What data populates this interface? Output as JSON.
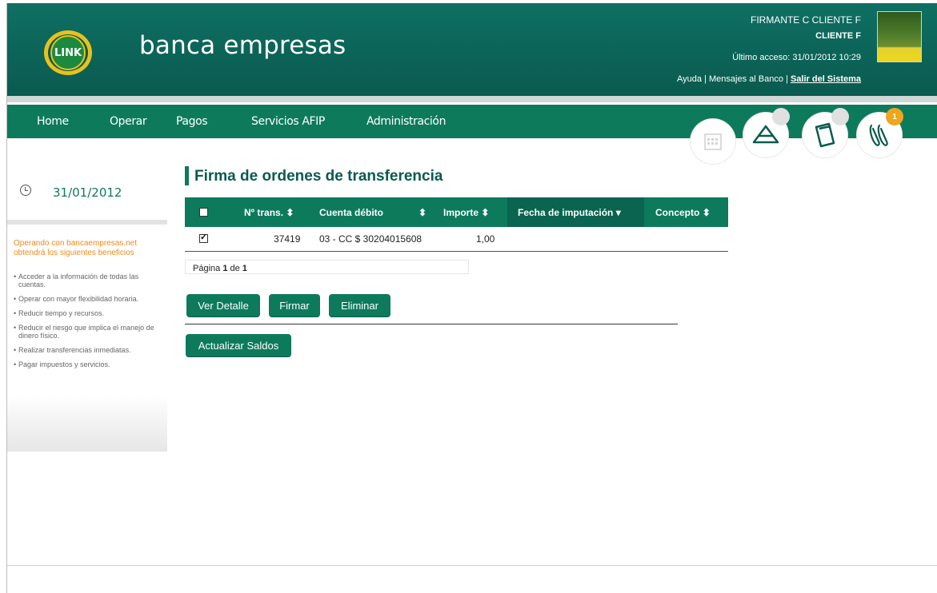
{
  "header": {
    "brand": "banca empresas",
    "logo_text": "LINK",
    "user_name": "FIRMANTE C CLIENTE F",
    "client": "CLIENTE F",
    "last_access": "Último acceso: 31/01/2012 10:29",
    "link_help": "Ayuda",
    "link_sep1": " | ",
    "link_messages": "Mensajes al Banco",
    "link_sep2": " | ",
    "link_exit": "Salir del Sistema"
  },
  "nav": {
    "items": [
      "Home",
      "Operar",
      "Pagos",
      "Servicios AFIP",
      "Administración"
    ],
    "icons": [
      "calendar-icon",
      "envelope-icon",
      "folder-icon",
      "paperclip-icon"
    ],
    "badge": "1"
  },
  "sidebar": {
    "date": "31/01/2012",
    "promo": "Operando con bancaempresas.net obtendrá los siguientes beneficios",
    "benefits": [
      "Acceder a la información de todas las cuentas.",
      "Operar con mayor flexibilidad horaria.",
      "Reducir tiempo y recursos.",
      "Reducir el riesgo que implica el manejo de dinero físico.",
      "Realizar transferencias inmediatas.",
      "Pagar impuestos y servicios."
    ]
  },
  "main": {
    "title": "Firma de ordenes de transferencia",
    "columns": [
      "Nº trans.",
      "Cuenta débito",
      "Importe",
      "Fecha de imputación",
      "Concepto"
    ],
    "sort_glyphs": [
      "⬍",
      "⬍",
      "⬍",
      "▾",
      "⬍"
    ],
    "rows": [
      {
        "checked": true,
        "trans": "37419",
        "account": "03 - CC $ 30204015608",
        "amount": "1,00",
        "date": "",
        "concept": ""
      }
    ],
    "pager_prefix": "Página ",
    "pager_page": "1",
    "pager_mid": " de ",
    "pager_total": "1",
    "buttons": {
      "detail": "Ver Detalle",
      "sign": "Firmar",
      "delete": "Eliminar",
      "refresh": "Actualizar Saldos"
    }
  },
  "colors": {
    "primary": "#0d7a5c",
    "header": "#0a5a4f",
    "accent": "#f08a1c"
  }
}
